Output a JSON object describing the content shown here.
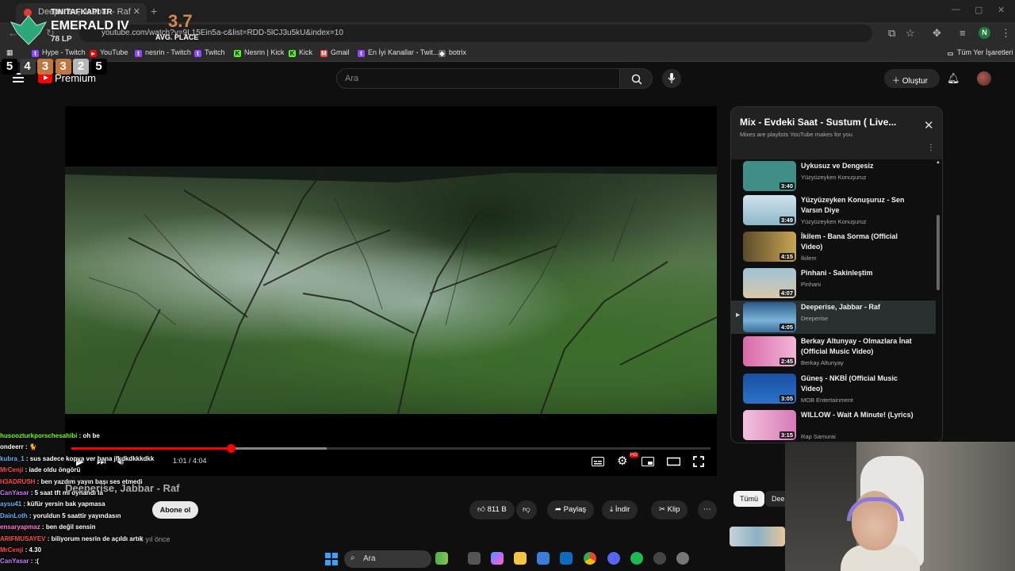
{
  "browser": {
    "tab_title": "Deeperise, Jabbar - Raf",
    "url": "youtube.com/watch?v=9L15Ein5a-c&list=RDD-5lCJ3u5kU&index=10",
    "bookmarks": [
      "Hype - Twitch",
      "YouTube",
      "nesrin - Twitch",
      "Twitch",
      "Nesrin | Kick",
      "Kick",
      "Gmail",
      "En İyi Kanallar - Twit...",
      "botrix"
    ],
    "bookmarks_right": "Tüm Yer İşaretleri",
    "profile_initial": "N"
  },
  "rank_overlay": {
    "name": "TINITAFKAPI TR",
    "tier": "EMERALD IV",
    "lp": "78 LP",
    "avg_value": "3.7",
    "avg_label": "AVG. PLACE",
    "placements": [
      "5",
      "4",
      "3",
      "3",
      "2",
      "5"
    ],
    "placement_colors": [
      "#000000",
      "#3a3a3a",
      "#c0763f",
      "#c0763f",
      "#b7b7b7",
      "#000000"
    ]
  },
  "youtube": {
    "premium_label": "Premium",
    "region": "TR",
    "search_placeholder": "Ara",
    "create_label": "Oluştur"
  },
  "player": {
    "time_current": "1:01",
    "time_total": "4:04",
    "progress": 0.25,
    "buffered": 0.4,
    "captions_icon": "subtitles-icon",
    "settings_icon": "gear-icon",
    "settings_badge": "HD"
  },
  "video": {
    "title": "Deeperise, Jabbar - Raf",
    "subscribe_label": "Abone ol",
    "likes": "811 B",
    "share_label": "Paylaş",
    "download_label": "İndir",
    "clip_label": "Klip",
    "uploaded": "8 yıl önce"
  },
  "playlist": {
    "title": "Mix - Evdeki Saat - Sustum ( Live...",
    "subtitle": "Mixes are playlists YouTube makes for you",
    "items": [
      {
        "title": "Uykusuz ve Dengesiz",
        "channel": "Yüzyüzeyken Konuşuruz",
        "duration": "3:40",
        "color": "#3f8f86"
      },
      {
        "title": "Yüzyüzeyken Konuşuruz - Sen Varsın Diye",
        "channel": "Yüzyüzeyken Konuşuruz",
        "duration": "3:49",
        "color": "#8fb6c9"
      },
      {
        "title": "İkilem - Bana Sorma (Official Video)",
        "channel": "İkilem",
        "duration": "4:15",
        "color": "#5b4a2b"
      },
      {
        "title": "Pinhani - Sakinleştim",
        "channel": "Pinhani",
        "duration": "4:07",
        "color": "#9ec3d6"
      },
      {
        "title": "Deeperise, Jabbar - Raf",
        "channel": "Deeperise",
        "duration": "4:05",
        "color": "#3b6f9e"
      },
      {
        "title": "Berkay Altunyay - Olmazlara İnat (Official Music Video)",
        "channel": "Berkay Altunyay",
        "duration": "2:45",
        "color": "#d86aa8"
      },
      {
        "title": "Güneş - NKBİ (Official Music Video)",
        "channel": "MOB Entertainment",
        "duration": "3:05",
        "color": "#2a73c8"
      },
      {
        "title": "WILLOW - Wait A Minute! (Lyrics)",
        "channel": "Rap Samurai",
        "duration": "3:15",
        "color": "#d77ab7"
      }
    ]
  },
  "chips": {
    "all": "Tümü",
    "second": "Dee"
  },
  "chat": [
    {
      "user": "husoozturkporschesahibi",
      "msg": "oh be",
      "color": "#7CFC00"
    },
    {
      "user": "ondeerr",
      "msg": "🐈",
      "color": "#ffffff"
    },
    {
      "user": "kubra_1",
      "msg": "sus sadece kopya ver bana jfkdkdkkkdkk",
      "color": "#5fb3ff"
    },
    {
      "user": "MrCenji",
      "msg": "iade oldu öngörü",
      "color": "#ff4d4d"
    },
    {
      "user": "H3ADRUSH",
      "msg": "ben yazdım yayın başı ses etmedi",
      "color": "#ff4d4d"
    },
    {
      "user": "CanYasar",
      "msg": "5 saat tft mi oynandı la",
      "color": "#c77dff"
    },
    {
      "user": "aysu41",
      "msg": "küfür yersin bak yapmasa",
      "color": "#5fb3ff"
    },
    {
      "user": "DainLoth",
      "msg": "yoruldun 5 saattir yayındasın",
      "color": "#5fb3ff"
    },
    {
      "user": "ensaryapmaz",
      "msg": "ben değil sensin",
      "color": "#ff7dd1"
    },
    {
      "user": "ARIFMUSAYEV",
      "msg": "biliyorum nesrin de açıldı artık",
      "color": "#ff4d4d"
    },
    {
      "user": "MrCenji",
      "msg": "4.30",
      "color": "#ff4d4d"
    },
    {
      "user": "CanYasar",
      "msg": ":(",
      "color": "#c77dff"
    }
  ],
  "taskbar": {
    "search_label": "Ara"
  }
}
